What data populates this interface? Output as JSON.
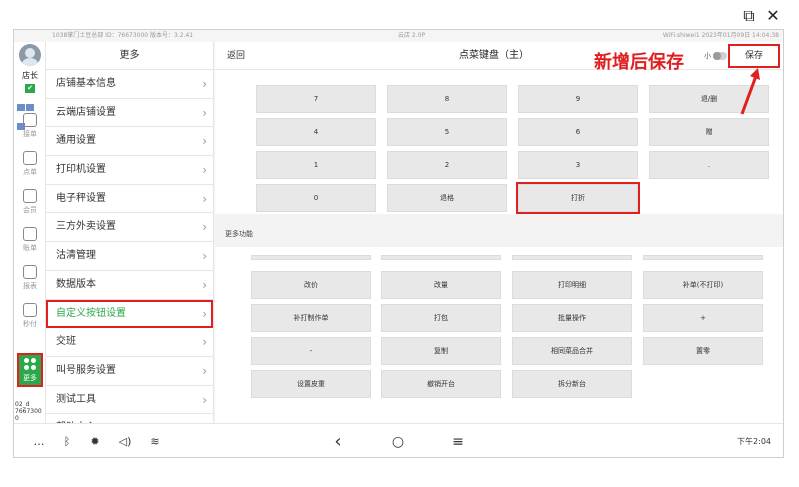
{
  "window_icons": {
    "popout": "external-link-icon",
    "close": "close-icon"
  },
  "status_bar": {
    "left": "1038掌门土豆总部 ID：76673000  版本号：3.2.41",
    "center": "云店 2.0P",
    "right": "WiFi:shiwei1  2023年01月09日 14:04:38"
  },
  "rail": {
    "role": "店长",
    "items": [
      {
        "label": "接单",
        "icon": "order-icon"
      },
      {
        "label": "点单",
        "icon": "menu-icon"
      },
      {
        "label": "会员",
        "icon": "member-icon"
      },
      {
        "label": "账单",
        "icon": "bill-icon"
      },
      {
        "label": "报表",
        "icon": "report-icon"
      },
      {
        "label": "秒付",
        "icon": "pay-icon"
      }
    ],
    "more_label": "更多",
    "footer_line1": "02_d",
    "footer_line2": "7667300",
    "footer_line3": "0"
  },
  "settings": {
    "title": "更多",
    "items": [
      "店铺基本信息",
      "云端店铺设置",
      "通用设置",
      "打印机设置",
      "电子秤设置",
      "三方外卖设置",
      "沽清管理",
      "数据版本",
      "自定义按钮设置",
      "交班",
      "叫号服务设置",
      "测试工具",
      "帮助中心"
    ],
    "active_index": 8
  },
  "main": {
    "back_label": "返回",
    "title": "点菜键盘（主）",
    "toggle_label": "小",
    "save_label": "保存",
    "keypad": [
      [
        "7",
        "8",
        "9",
        "退/删"
      ],
      [
        "4",
        "5",
        "6",
        "赠"
      ],
      [
        "1",
        "2",
        "3",
        "."
      ],
      [
        "0",
        "退格",
        "打折"
      ]
    ],
    "highlighted_key": "打折",
    "section_label": "更多功能",
    "functions": [
      [
        "改价",
        "改量",
        "打印明细",
        "补单(不打印)"
      ],
      [
        "补打制作单",
        "打包",
        "批量操作",
        "+"
      ],
      [
        "-",
        "复制",
        "相同菜品合并",
        "置零"
      ],
      [
        "设置皮重",
        "撤销开台",
        "拆分新台"
      ]
    ]
  },
  "navbar": {
    "items": [
      "…",
      "bluetooth-icon",
      "brightness-icon",
      "volume-icon",
      "wifi-icon"
    ],
    "back": "‹",
    "home": "○",
    "recents": "≡",
    "time": "下午2:04"
  },
  "annotation": {
    "text": "新增后保存",
    "color": "#e02020"
  },
  "colors": {
    "accent": "#2aa84a",
    "highlight": "#e02020"
  }
}
